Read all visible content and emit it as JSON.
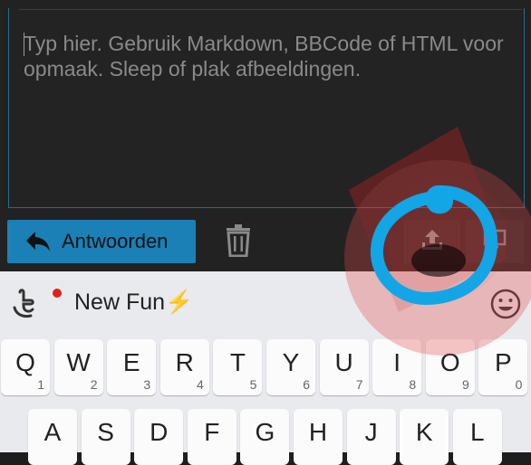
{
  "editor": {
    "placeholder": "Typ hier. Gebruik Markdown, BBCode of HTML voor opmaak. Sleep of plak afbeeldingen."
  },
  "toolbar": {
    "reply_label": "Antwoorden",
    "reply_icon": "reply-arrow-icon",
    "trash_icon": "trash-icon",
    "upload_icon": "upload-icon",
    "preview_icon": "monitor-icon"
  },
  "keyboard": {
    "suggestion": "New Fun",
    "suggestion_emoji": "⚡",
    "row1": [
      {
        "ch": "Q",
        "num": "1"
      },
      {
        "ch": "W",
        "num": "2"
      },
      {
        "ch": "E",
        "num": "3"
      },
      {
        "ch": "R",
        "num": "4"
      },
      {
        "ch": "T",
        "num": "5"
      },
      {
        "ch": "Y",
        "num": "6"
      },
      {
        "ch": "U",
        "num": "7"
      },
      {
        "ch": "I",
        "num": "8"
      },
      {
        "ch": "O",
        "num": "9"
      },
      {
        "ch": "P",
        "num": "0"
      }
    ],
    "row2": [
      "A",
      "S",
      "D",
      "F",
      "G",
      "H",
      "J",
      "K",
      "L"
    ]
  },
  "colors": {
    "accent": "#1a80b6",
    "annotation_red": "#e04545",
    "annotation_blue": "#12a6e6"
  }
}
